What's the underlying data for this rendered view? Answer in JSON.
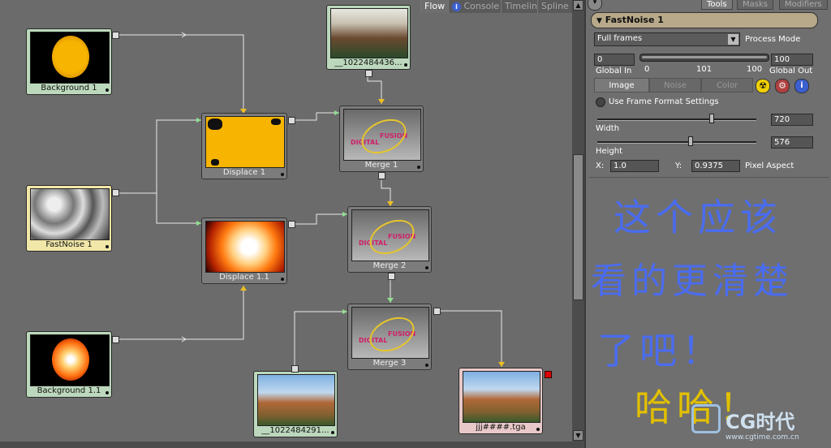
{
  "flow_tabs": [
    "Flow",
    "Console",
    "Timeline",
    "Spline"
  ],
  "nodes": {
    "bg1": "Background 1",
    "fastnoise": "FastNoise 1",
    "bg11": "Background 1.1",
    "displace1": "Displace 1",
    "displace11": "Displace 1.1",
    "merge1": "Merge 1",
    "merge2": "Merge 2",
    "merge3": "Merge 3",
    "loader_top": "__1022484436...",
    "loader_bottom": "__1022484291...",
    "saver": "jjj####.tga"
  },
  "merge_logo": {
    "line1": "DIGITAL",
    "line2": "FUSION"
  },
  "panel_tabs": [
    "Tools",
    "Masks",
    "Modifiers"
  ],
  "tool": {
    "name": "FastNoise 1",
    "process_select": "Full frames",
    "process_mode_label": "Process Mode",
    "global_in_value": "0",
    "global_out_value": "100",
    "ruler": [
      "0",
      "101",
      "100"
    ],
    "global_in_label": "Global In",
    "global_out_label": "Global Out",
    "sub_tabs": [
      "Image",
      "Noise",
      "Color"
    ],
    "use_frame_format": "Use Frame Format Settings",
    "width_label": "Width",
    "width_value": "720",
    "height_label": "Height",
    "height_value": "576",
    "x_label": "X:",
    "x_value": "1.0",
    "y_label": "Y:",
    "y_value": "0.9375",
    "pixel_aspect": "Pixel Aspect"
  },
  "handwriting": {
    "line1": "这个应该",
    "line2": "看的更清楚",
    "line3": "了吧！",
    "line4": "哈哈！"
  },
  "watermark": {
    "brand": "CG时代",
    "url": "www.cgtime.com.cn"
  },
  "colors": {
    "node_green": "#bcd8bc",
    "node_yellow": "#f1e7a8",
    "node_pink": "#e8c8c8",
    "handwriting": "#4a6cf0",
    "tool_header": "#b7a98a"
  }
}
